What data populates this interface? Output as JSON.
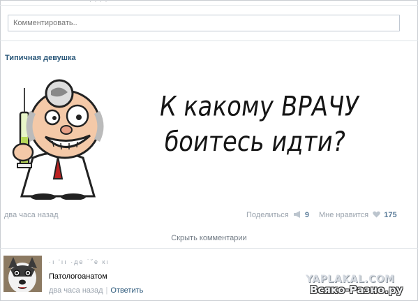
{
  "top_fragment": "· · · ·",
  "comment_input": {
    "placeholder": "Комментировать.."
  },
  "post": {
    "author": "Типичная девушка",
    "image_text": {
      "line1": "К какому ВРАЧУ",
      "line2": "боитесь идти?"
    },
    "time": "два часа назад",
    "share_label": "Поделиться",
    "share_count": "9",
    "like_label": "Мне нравится",
    "like_count": "175"
  },
  "hide_comments_label": "Скрыть комментарии",
  "comment": {
    "author": "·ı 'ıı ·де ˙˘е кı",
    "text": "Патологоанатом",
    "time": "два часа назад",
    "reply_label": "Ответить"
  },
  "watermarks": {
    "yaplakal": "YAPLAKAL.COM",
    "vsyako": "Всяко-Разно.ру"
  },
  "colors": {
    "link": "#2b587a",
    "meta": "#9aa3ad",
    "count": "#5d7e9b",
    "border": "#c0c8d2"
  },
  "icons": {
    "share": "megaphone-icon",
    "like": "heart-icon"
  }
}
